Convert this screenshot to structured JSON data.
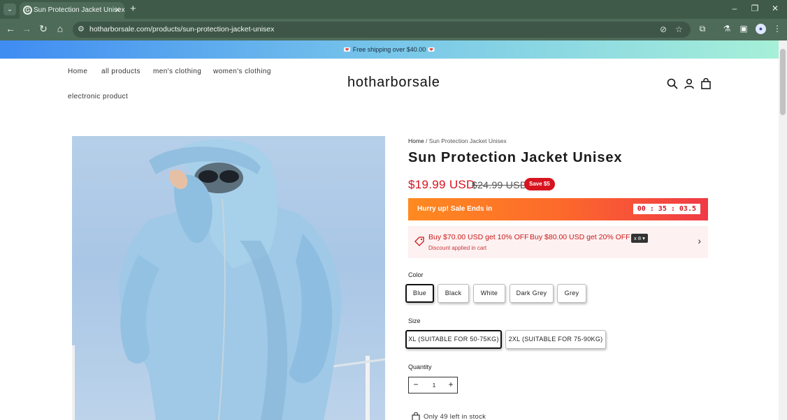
{
  "browser": {
    "tab_title": "Sun Protection Jacket Unisex",
    "url": "hotharborsale.com/products/sun-protection-jacket-unisex"
  },
  "announcement": {
    "text": "💌 Free shipping over $40.00 💌"
  },
  "header": {
    "logo": "hotharborsale",
    "nav": [
      "Home",
      "all products",
      "men's clothing",
      "women's clothing",
      "electronic product"
    ]
  },
  "product": {
    "breadcrumb_home": "Home",
    "breadcrumb_sep": " / ",
    "breadcrumb_current": "Sun Protection Jacket Unisex",
    "title": "Sun Protection Jacket Unisex",
    "price": "$19.99 USD",
    "compare_price": "$24.99 USD",
    "save_badge": "Save $5",
    "sale_banner": "Hurry up! Sale Ends in",
    "timer": "00 : 35 : 03.5",
    "discount_offer_1": "Buy $70.00 USD get 10% OFF",
    "discount_offer_2": "Buy $80.00 USD get 20% OFF",
    "discount_count": "x 8",
    "discount_note": "Discount applied in cart",
    "color_label": "Color",
    "colors": [
      "Blue",
      "Black",
      "White",
      "Dark Grey",
      "Grey"
    ],
    "selected_color": "Blue",
    "size_label": "Size",
    "sizes": [
      "XL (SUITABLE FOR 50-75KG)",
      "2XL (SUITABLE FOR 75-90KG)"
    ],
    "selected_size": "XL (SUITABLE FOR 50-75KG)",
    "quantity_label": "Quantity",
    "quantity": "1",
    "stock_text": "Only 49 left in stock"
  },
  "colors": {
    "accent_red": "#d6131f",
    "browser_frame": "#4e6b5a",
    "sale_gradient_start": "#fe8a20",
    "sale_gradient_end": "#f03a46"
  }
}
